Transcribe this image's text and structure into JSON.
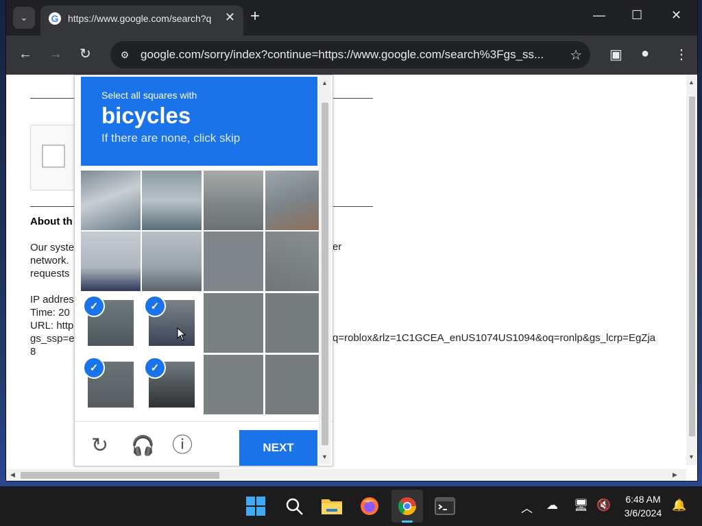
{
  "browser": {
    "tab_title": "https://www.google.com/search?q=",
    "url": "google.com/sorry/index?continue=https://www.google.com/search%3Fgs_ss...",
    "tab_list_icon": "chevron-down-icon",
    "tab_close": "✕",
    "new_tab": "+",
    "minimize": "—",
    "maximize": "☐",
    "close": "✕",
    "back": "←",
    "forward": "→",
    "reload": "↻",
    "bookmark": "☆",
    "side_panel": "▣",
    "profile": "●",
    "menu": "⋮"
  },
  "page": {
    "about_title": "About th",
    "lines_left": [
      "Our syste",
      "network.",
      "requests"
    ],
    "info_left": [
      "IP addres",
      "Time: 20",
      "URL: http",
      "gs_ssp=e",
      "8"
    ],
    "right_line1": "er",
    "right_line2": "q=roblox&rlz=1C1GCEA_enUS1074US1094&oq=ronlp&gs_lcrp=EgZja"
  },
  "captcha": {
    "subtitle": "Select all squares with",
    "target": "bicycles",
    "hint": "If there are none, click skip",
    "next_label": "NEXT",
    "reload_icon": "↻",
    "audio_icon": "🎧",
    "info_icon": "ⓘ",
    "check_glyph": "✓",
    "selected_tiles": [
      "row3-col1",
      "row3-col2",
      "row4-col1",
      "row4-col2"
    ]
  },
  "taskbar": {
    "time": "6:48 AM",
    "date": "3/6/2024",
    "apps": [
      "start",
      "search",
      "file-explorer",
      "firefox",
      "chrome",
      "terminal"
    ],
    "tray_chevron": "^",
    "notification": "🔔"
  }
}
